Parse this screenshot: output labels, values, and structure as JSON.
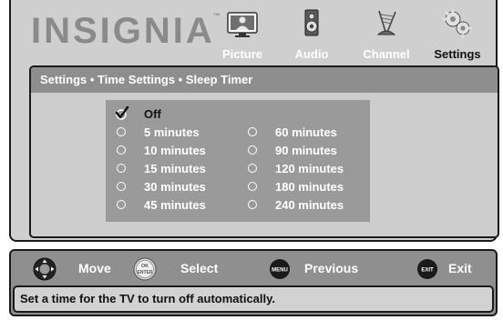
{
  "brand": {
    "logo_text": "INSIGNIA",
    "trademark": "™",
    "color": "#8a8a8a"
  },
  "tabs": [
    {
      "label": "Picture",
      "icon": "picture-icon",
      "active": false
    },
    {
      "label": "Audio",
      "icon": "speaker-icon",
      "active": false
    },
    {
      "label": "Channel",
      "icon": "antenna-icon",
      "active": false
    },
    {
      "label": "Settings",
      "icon": "gears-icon",
      "active": true
    }
  ],
  "breadcrumb": "Settings • Time Settings • Sleep Timer",
  "sleep_timer_options": {
    "left_column": [
      {
        "label": "Off",
        "selected": true
      },
      {
        "label": "5 minutes",
        "selected": false
      },
      {
        "label": "10 minutes",
        "selected": false
      },
      {
        "label": "15 minutes",
        "selected": false
      },
      {
        "label": "30 minutes",
        "selected": false
      },
      {
        "label": "45 minutes",
        "selected": false
      }
    ],
    "right_column": [
      {
        "label": "60 minutes",
        "selected": false
      },
      {
        "label": "90 minutes",
        "selected": false
      },
      {
        "label": "120 minutes",
        "selected": false
      },
      {
        "label": "180 minutes",
        "selected": false
      },
      {
        "label": "240 minutes",
        "selected": false
      }
    ]
  },
  "controls": {
    "move": {
      "label": "Move",
      "icon": "dpad-icon"
    },
    "select": {
      "label": "Select",
      "icon": "ok-enter-icon",
      "icon_text_top": "OK",
      "icon_text_bottom": "ENTER"
    },
    "previous": {
      "label": "Previous",
      "icon": "menu-button-icon",
      "icon_text": "MENU"
    },
    "exit": {
      "label": "Exit",
      "icon": "exit-button-icon",
      "icon_text": "EXIT"
    }
  },
  "help_text": "Set a time for the TV to turn off automatically.",
  "colors": {
    "panel_light": "#cfcfcf",
    "panel_dark": "#8f8f8f",
    "breadcrumb_bar": "#8e8e8e",
    "options_box": "#9a9a9a",
    "selected_text": "#111111",
    "unselected_text": "#ffffff"
  }
}
